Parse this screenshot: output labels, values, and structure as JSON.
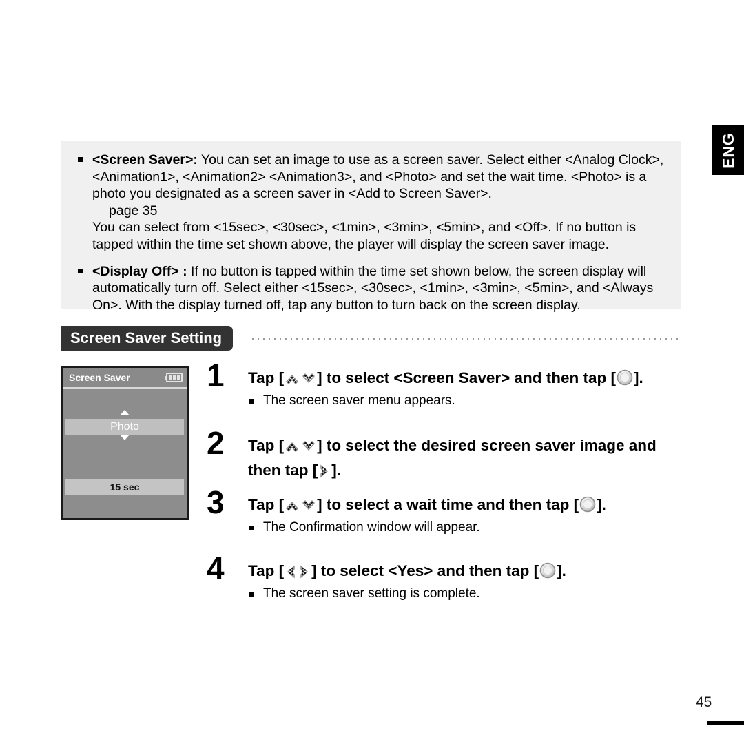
{
  "lang_tab": {
    "label": "ENG"
  },
  "note_box": {
    "paragraphs": [
      {
        "bold_lead": "<Screen Saver>:",
        "text": " You can set an image to use as a screen saver. Select either <Analog Clock>, <Animation1>, <Animation2> <Animation3>, and <Photo> and set the wait time. <Photo> is a photo you designated as a screen saver in <Add to Screen Saver>.",
        "page_ref": "page 35",
        "text2": "You can select from <15sec>, <30sec>, <1min>, <3min>, <5min>, and <Off>. If no button is tapped within the time set shown above, the player will display the screen saver image."
      },
      {
        "bold_lead": "<Display Off> :",
        "text": " If no button is tapped within the time set shown below, the screen display will automatically turn off. Select either <15sec>, <30sec>, <1min>, <3min>, <5min>, and <Always On>. With the display turned off, tap any button to turn back on the screen display."
      }
    ]
  },
  "section": {
    "title": "Screen Saver Setting"
  },
  "device": {
    "title": "Screen Saver",
    "battery_icon": "battery-icon",
    "selected_item": "Photo",
    "wait_time": "15 sec",
    "arrow_up_icon": "arrow-up-icon",
    "arrow_down_icon": "arrow-down-icon"
  },
  "steps": [
    {
      "number": "1",
      "text_a": "Tap [",
      "icons": [
        "up-chevron-icon",
        "down-chevron-icon"
      ],
      "text_b": "] to select <Screen Saver> and then tap [",
      "icon_b": "select-circle-icon",
      "text_c": "].",
      "sub": "The screen saver menu appears."
    },
    {
      "number": "2",
      "text_a": "Tap [",
      "icons": [
        "up-chevron-icon",
        "down-chevron-icon"
      ],
      "text_b": "] to select the desired screen saver image and then tap [",
      "icon_b": "right-chevron-icon",
      "text_c": "].",
      "sub": ""
    },
    {
      "number": "3",
      "text_a": "Tap [",
      "icons": [
        "up-chevron-icon",
        "down-chevron-icon"
      ],
      "text_b": "] to select a wait time and then tap [",
      "icon_b": "select-circle-icon",
      "text_c": "].",
      "sub": "The Confirmation window will appear."
    },
    {
      "number": "4",
      "text_a": "Tap [",
      "icons": [
        "left-chevron-icon",
        "right-chevron-icon"
      ],
      "text_b": "] to select <Yes> and then tap [",
      "icon_b": "select-circle-icon",
      "text_c": "].",
      "sub": "The screen saver setting is complete."
    }
  ],
  "footer": {
    "page_number": "45"
  },
  "colors": {
    "note_bg": "#f0f0f0",
    "heading_bg": "#333333",
    "device_bg": "#8d8d8d",
    "highlight_row": "#bfbfbf",
    "accent_black": "#000000"
  }
}
